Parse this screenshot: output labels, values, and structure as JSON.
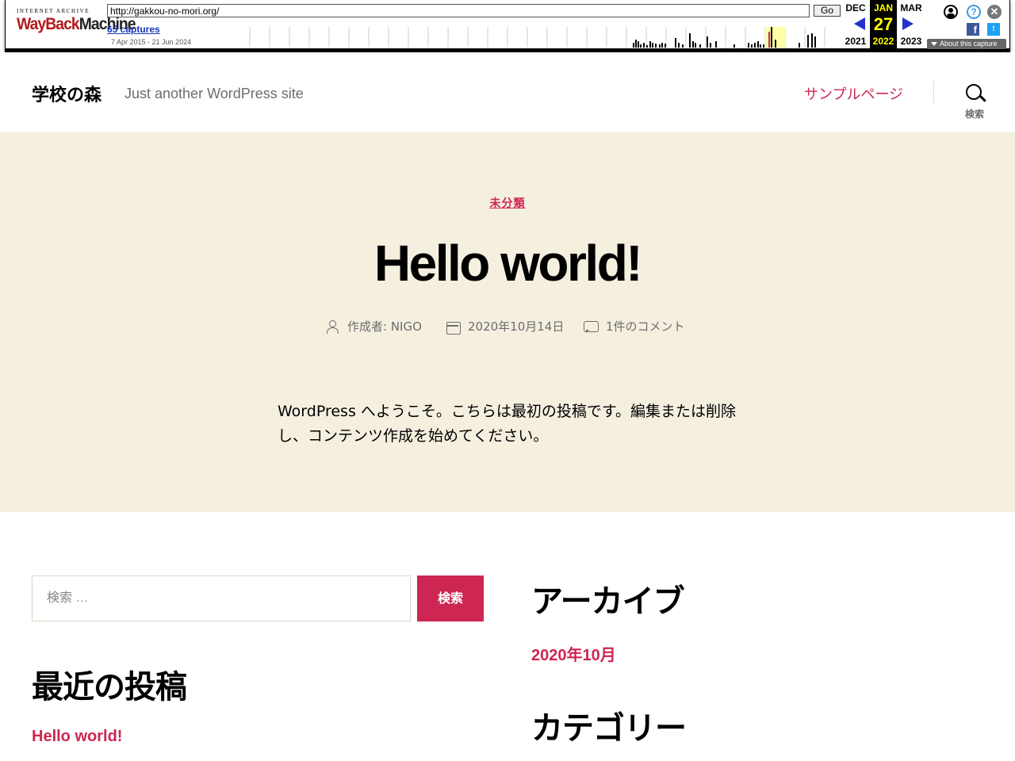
{
  "wayback": {
    "logo_top": "INTERNET ARCHIVE",
    "logo_main": "WayBack",
    "logo_main2": "Machine",
    "url_value": "http://gakkou-no-mori.org/",
    "go_label": "Go",
    "captures_label": "65 captures",
    "date_range": "7 Apr 2015 - 21 Jun 2024",
    "prev_month": "DEC",
    "prev_year": "2021",
    "cur_month": "JAN",
    "cur_day": "27",
    "cur_year": "2022",
    "next_month": "MAR",
    "next_year": "2023",
    "help_glyph": "?",
    "close_glyph": "✕",
    "fb_glyph": "f",
    "tw_glyph": "t",
    "about_label": "About this capture"
  },
  "header": {
    "site_title": "学校の森",
    "site_description": "Just another WordPress site",
    "nav_items": [
      {
        "label": "サンプルページ"
      }
    ],
    "search_toggle_label": "検索"
  },
  "post": {
    "category": "未分類",
    "title": "Hello world!",
    "author": "作成者: NIGO",
    "date": "2020年10月14日",
    "comments": "1件のコメント",
    "body": "WordPress へようこそ。こちらは最初の投稿です。編集または削除し、コンテンツ作成を始めてください。"
  },
  "widgets": {
    "search_placeholder": "検索 …",
    "search_button": "検索",
    "recent_title": "最近の投稿",
    "recent_posts": [
      "Hello world!"
    ],
    "archive_title": "アーカイブ",
    "archives": [
      "2020年10月"
    ],
    "category_title": "カテゴリー"
  },
  "colors": {
    "accent": "#cd2653",
    "hero_bg": "#f5efe0",
    "meta_text": "#6d6d6d"
  }
}
